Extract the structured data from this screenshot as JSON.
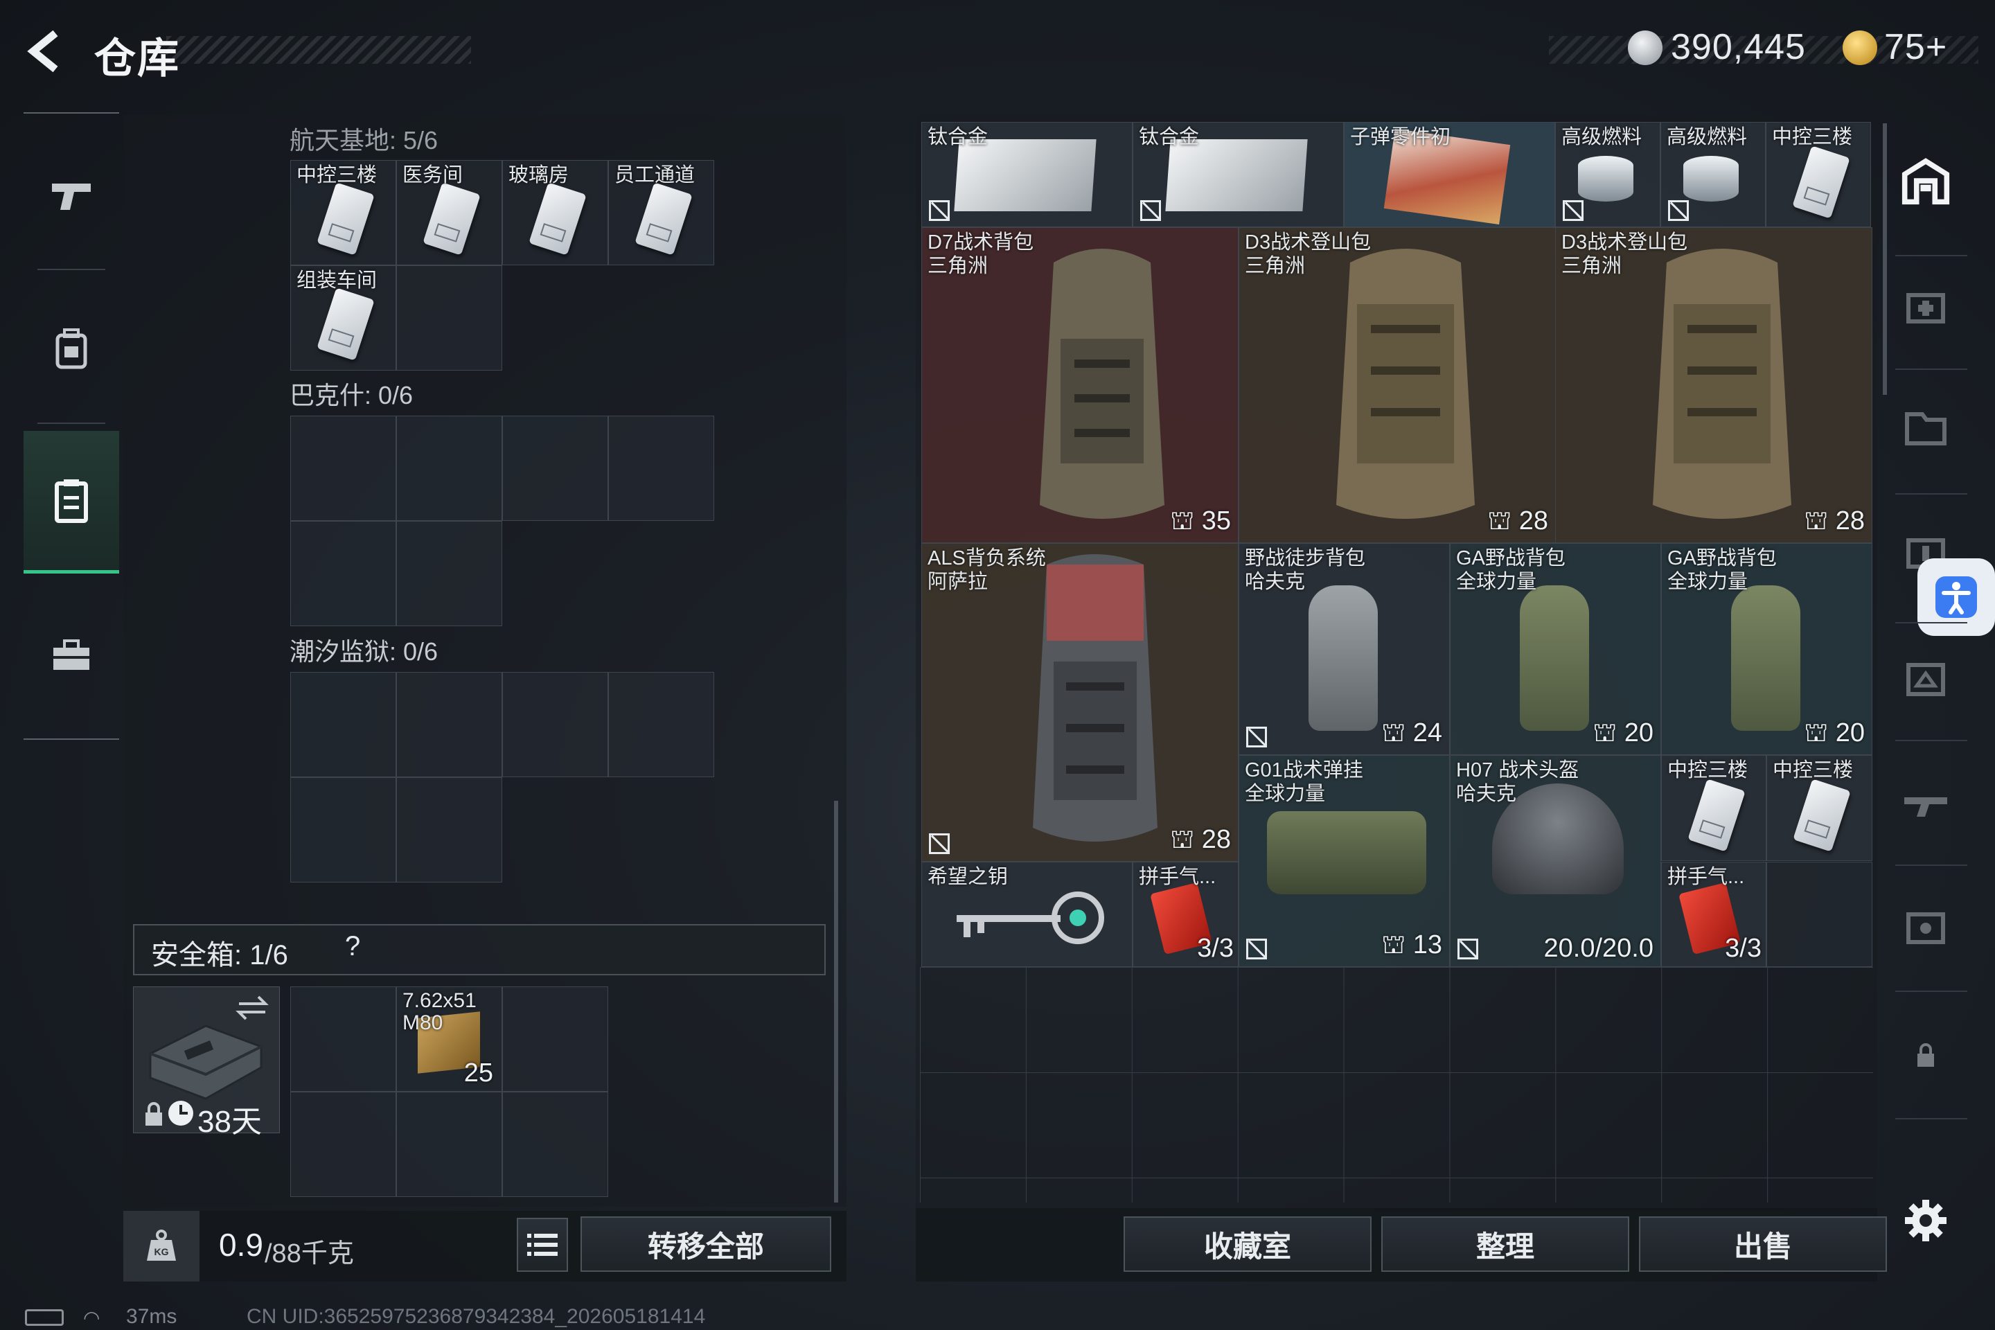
{
  "header": {
    "title": "仓库",
    "currency_amount": "390,445",
    "premium_amount": "75+"
  },
  "left_nav": {
    "items": [
      {
        "icon": "pistol-icon"
      },
      {
        "icon": "backpack-icon"
      },
      {
        "icon": "safe-box-icon"
      },
      {
        "icon": "toolbox-icon"
      }
    ]
  },
  "key_storage": {
    "sections": [
      {
        "label": "航天基地: 5/6",
        "items": [
          "中控三楼",
          "医务间",
          "玻璃房",
          "员工通道",
          "组装车间"
        ]
      },
      {
        "label": "巴克什: 0/6"
      },
      {
        "label": "潮汐监狱: 0/6"
      }
    ]
  },
  "safe_box": {
    "label": "安全箱: 1/6",
    "help": "?",
    "time_left": "38天",
    "ammo_name": "7.62x51\nM80",
    "ammo_count": "25"
  },
  "weight": {
    "current": "0.9",
    "max": "/88千克"
  },
  "buttons": {
    "transfer_all": "转移全部",
    "collection": "收藏室",
    "organize": "整理",
    "sell": "出售"
  },
  "inventory": {
    "titanium1": "钛合金",
    "titanium2": "钛合金",
    "bullet_parts": "子弹零件初",
    "fuel1": "高级燃料",
    "fuel2": "高级燃料",
    "key_top": "中控三楼",
    "d7": "D7战术背包\n三角洲",
    "d7_count": "35",
    "d3a": "D3战术登山包\n三角洲",
    "d3a_count": "28",
    "d3b": "D3战术登山包\n三角洲",
    "d3b_count": "28",
    "als": "ALS背负系统\n阿萨拉",
    "als_count": "28",
    "field": "野战徒步背包\n哈夫克",
    "field_count": "24",
    "ga1": "GA野战背包\n全球力量",
    "ga1_count": "20",
    "ga2": "GA野战背包\n全球力量",
    "ga2_count": "20",
    "g01": "G01战术弹挂\n全球力量",
    "g01_count": "13",
    "h07": "H07 战术头盔\n哈夫克",
    "h07_durability": "20.0/20.0",
    "key_a": "中控三楼",
    "key_b": "中控三楼",
    "hope_key": "希望之钥",
    "puzzle1": "拼手气...",
    "puzzle1_count": "3/3",
    "puzzle2": "拼手气...",
    "puzzle2_count": "3/3"
  },
  "status": {
    "ping": "37ms",
    "uid": "CN UID:36525975236879342384_202605181414"
  }
}
